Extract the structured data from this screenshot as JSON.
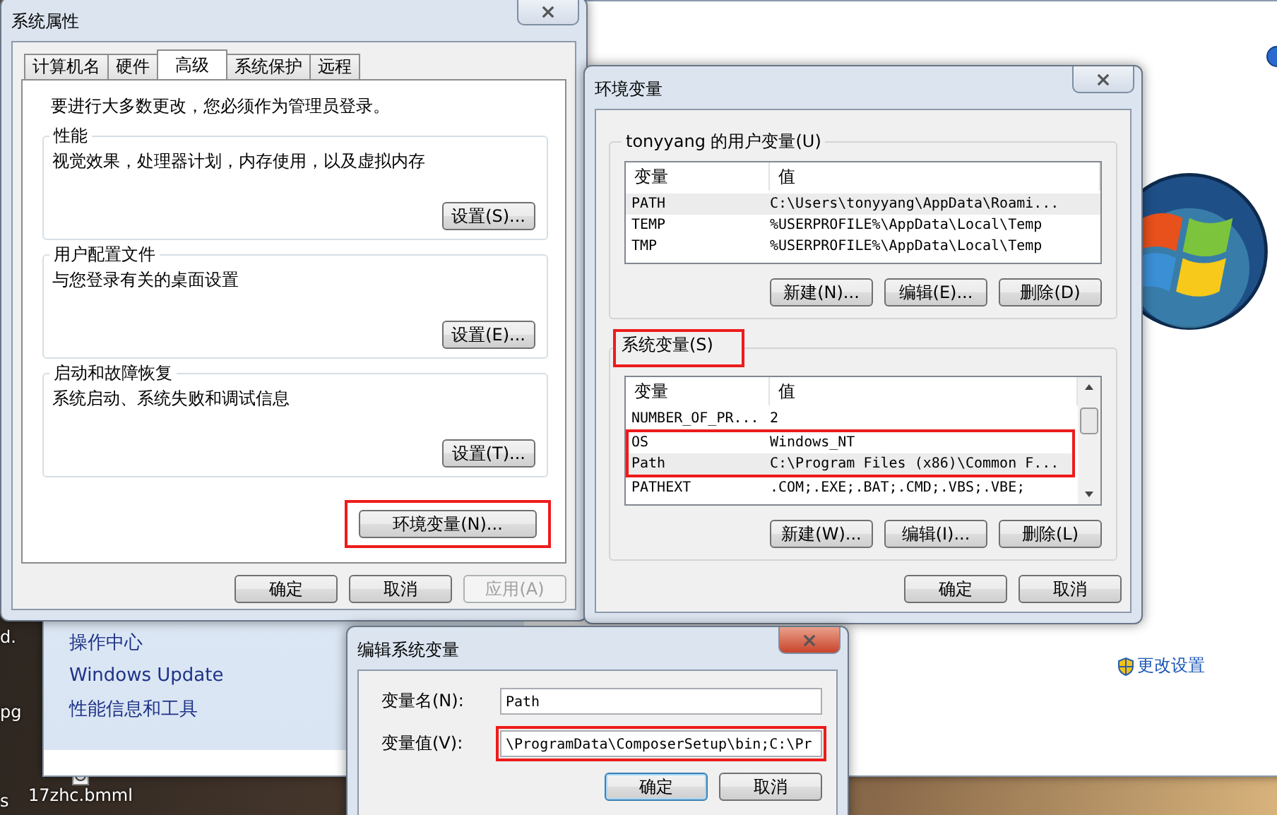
{
  "background_window": {
    "links": [
      {
        "label": "操作中心"
      },
      {
        "label": "Windows Update"
      },
      {
        "label": "性能信息和工具"
      }
    ],
    "change_settings": "更改设置"
  },
  "desktop_icons": [
    {
      "label": "d."
    },
    {
      "label": "pg"
    },
    {
      "label": "s"
    },
    {
      "label": "17zhc.bmml"
    }
  ],
  "system_properties": {
    "title": "系统属性",
    "tabs": [
      {
        "label": "计算机名",
        "selected": false
      },
      {
        "label": "硬件",
        "selected": false
      },
      {
        "label": "高级",
        "selected": true
      },
      {
        "label": "系统保护",
        "selected": false
      },
      {
        "label": "远程",
        "selected": false
      }
    ],
    "notice": "要进行大多数更改，您必须作为管理员登录。",
    "groups": [
      {
        "title": "性能",
        "description": "视觉效果，处理器计划，内存使用，以及虚拟内存",
        "button": "设置(S)..."
      },
      {
        "title": "用户配置文件",
        "description": "与您登录有关的桌面设置",
        "button": "设置(E)..."
      },
      {
        "title": "启动和故障恢复",
        "description": "系统启动、系统失败和调试信息",
        "button": "设置(T)..."
      }
    ],
    "environment_button": {
      "label": "环境变量(N)...",
      "highlighted": true
    },
    "buttons": [
      {
        "label": "确定",
        "disabled": false
      },
      {
        "label": "取消",
        "disabled": false
      },
      {
        "label": "应用(A)",
        "disabled": true
      }
    ]
  },
  "environment_variables": {
    "title": "环境变量",
    "user_variables": {
      "title": "tonyyang 的用户变量(U)",
      "columns": [
        "变量",
        "值"
      ],
      "rows": [
        {
          "name": "PATH",
          "value": "C:\\Users\\tonyyang\\AppData\\Roami...",
          "selected": true
        },
        {
          "name": "TEMP",
          "value": "%USERPROFILE%\\AppData\\Local\\Temp",
          "selected": false
        },
        {
          "name": "TMP",
          "value": "%USERPROFILE%\\AppData\\Local\\Temp",
          "selected": false
        }
      ],
      "buttons": [
        "新建(N)...",
        "编辑(E)...",
        "删除(D)"
      ]
    },
    "system_variables": {
      "title": "系统变量(S)",
      "highlighted": true,
      "columns": [
        "变量",
        "值"
      ],
      "rows": [
        {
          "name": "NUMBER_OF_PR...",
          "value": "2",
          "selected": false
        },
        {
          "name": "OS",
          "value": "Windows_NT",
          "selected": false,
          "highlighted": true
        },
        {
          "name": "Path",
          "value": "C:\\Program Files (x86)\\Common F...",
          "selected": true,
          "highlighted": true
        },
        {
          "name": "PATHEXT",
          "value": ".COM;.EXE;.BAT;.CMD;.VBS;.VBE;",
          "selected": false
        }
      ],
      "buttons": [
        "新建(W)...",
        "编辑(I)...",
        "删除(L)"
      ]
    },
    "buttons": [
      "确定",
      "取消"
    ]
  },
  "edit_dialog": {
    "title": "编辑系统变量",
    "fields": [
      {
        "label": "变量名(N):",
        "value": "Path"
      },
      {
        "label": "变量值(V):",
        "value": "\\ProgramData\\ComposerSetup\\bin;C:\\Pr",
        "highlighted": true
      }
    ],
    "buttons": [
      "确定",
      "取消"
    ]
  }
}
